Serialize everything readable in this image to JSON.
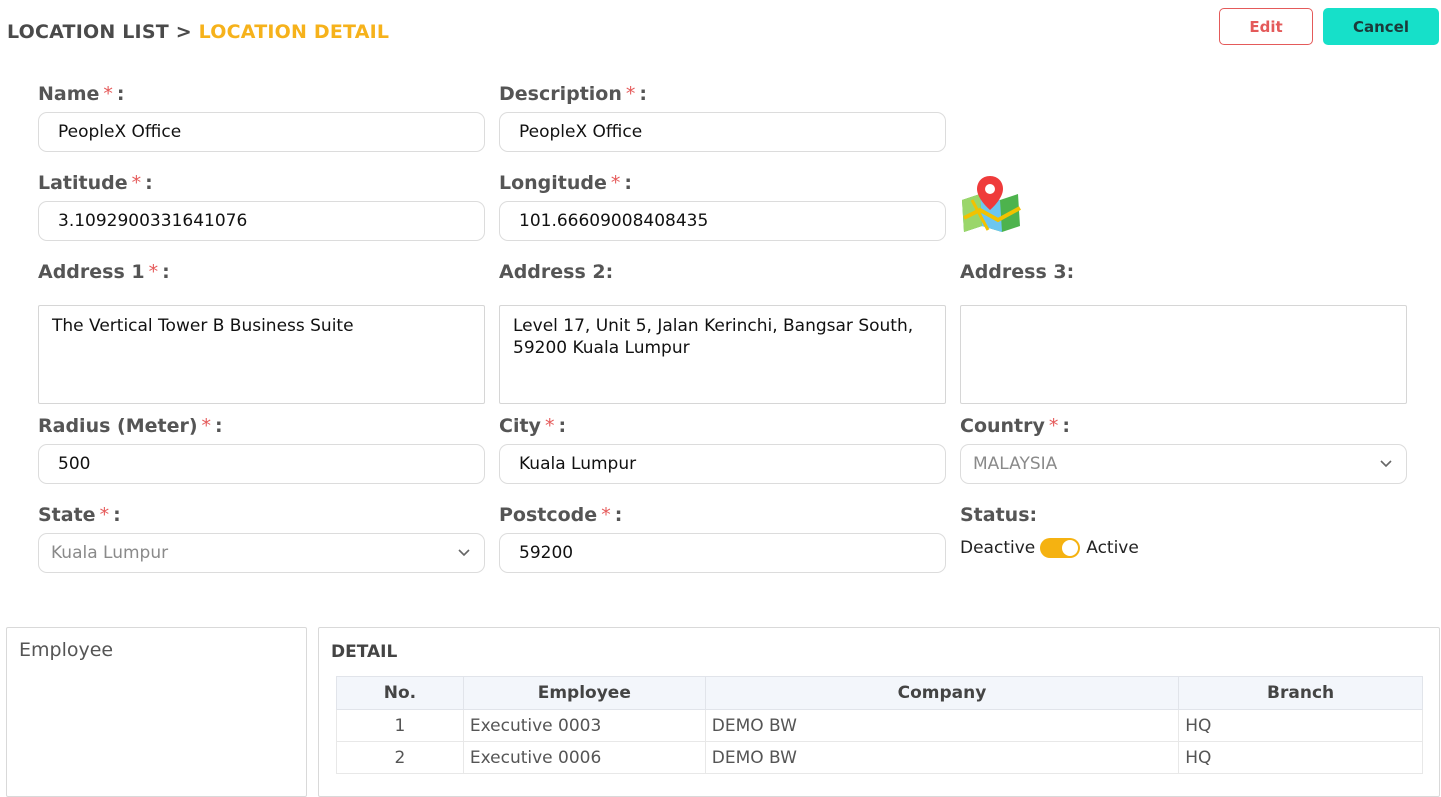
{
  "breadcrumb": {
    "parent": "LOCATION LIST",
    "separator": ">",
    "current": "LOCATION DETAIL"
  },
  "toolbar": {
    "edit_label": "Edit",
    "cancel_label": "Cancel"
  },
  "colors": {
    "accent": "#f6b21b",
    "required": "#e55a5a",
    "cancel_bg": "#16e0c9",
    "edit_border": "#e45a5a",
    "toggle_on": "#f5b211"
  },
  "form": {
    "name": {
      "label": "Name",
      "value": "PeopleX Office"
    },
    "description": {
      "label": "Description",
      "value": "PeopleX Office"
    },
    "latitude": {
      "label": "Latitude",
      "value": "3.1092900331641076"
    },
    "longitude": {
      "label": "Longitude",
      "value": "101.66609008408435"
    },
    "address1": {
      "label": "Address 1",
      "value": "The Vertical Tower B Business Suite"
    },
    "address2": {
      "label": "Address 2:",
      "value": "Level 17, Unit 5, Jalan Kerinchi, Bangsar South, 59200 Kuala Lumpur"
    },
    "address3": {
      "label": "Address 3:",
      "value": ""
    },
    "radius": {
      "label": "Radius (Meter)",
      "value": "500"
    },
    "city": {
      "label": "City",
      "value": "Kuala Lumpur"
    },
    "country": {
      "label": "Country",
      "value": "MALAYSIA"
    },
    "state": {
      "label": "State",
      "value": "Kuala Lumpur"
    },
    "postcode": {
      "label": "Postcode",
      "value": "59200"
    },
    "status": {
      "label": "Status:",
      "off_label": "Deactive",
      "on_label": "Active",
      "active": true
    },
    "required_mark": "*",
    "colon": ":",
    "map_icon": "map-pin-icon"
  },
  "employee_panel": {
    "title": "Employee"
  },
  "detail_panel": {
    "title": "DETAIL",
    "columns": [
      "No.",
      "Employee",
      "Company",
      "Branch"
    ],
    "rows": [
      {
        "no": "1",
        "employee": "Executive 0003",
        "company": "DEMO BW",
        "branch": "HQ"
      },
      {
        "no": "2",
        "employee": "Executive 0006",
        "company": "DEMO BW",
        "branch": "HQ"
      }
    ]
  }
}
